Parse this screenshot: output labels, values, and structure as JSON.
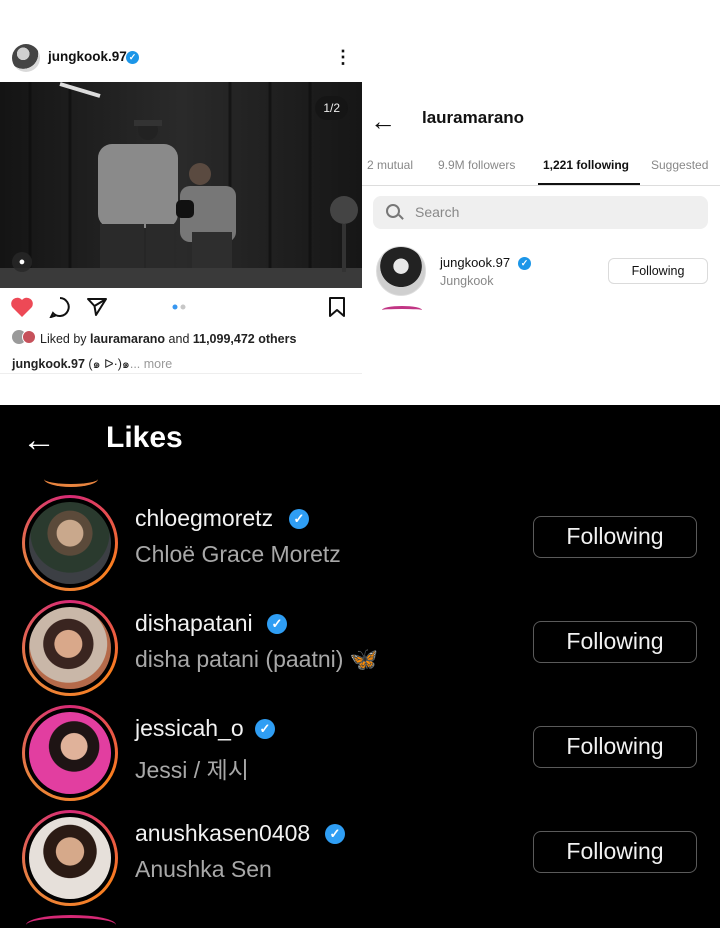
{
  "post": {
    "username": "jungkook.97",
    "menu_glyph": "⋮",
    "pager": "1/2",
    "liked_by_prefix": "Liked by ",
    "liked_by_user": "lauramarano",
    "liked_by_mid": " and ",
    "liked_by_count": "11,099,472 others",
    "caption_user": "jungkook.97",
    "caption_text": " (๑ ᐅ·)๑",
    "caption_more": "... more"
  },
  "profile": {
    "back_glyph": "←",
    "username": "lauramarano",
    "tabs": [
      "2 mutual",
      "9.9M followers",
      "1,221 following",
      "Suggested"
    ],
    "active_tab": "1,221 following",
    "search_placeholder": "Search",
    "row": {
      "username": "jungkook.97",
      "full_name": "Jungkook",
      "button": "Following"
    }
  },
  "likes": {
    "back_glyph": "←",
    "title": "Likes",
    "users": [
      {
        "username": "chloegmoretz",
        "full_name": "Chloë Grace Moretz",
        "button": "Following"
      },
      {
        "username": "dishapatani",
        "full_name": "disha patani (paatni) 🦋",
        "button": "Following"
      },
      {
        "username": "jessicah_o",
        "full_name": "Jessi / 제시",
        "button": "Following"
      },
      {
        "username": "anushkasen0408",
        "full_name": "Anushka Sen",
        "button": "Following"
      }
    ]
  },
  "colors": {
    "verified_blue": "#2f9ef4",
    "like_red": "#ed4956",
    "story_ring_a": "#d62976",
    "story_ring_b": "#fa7e1e"
  },
  "icons": {
    "like": "heart-icon",
    "comment": "comment-icon",
    "share": "send-icon",
    "save": "bookmark-icon",
    "tag": "person-tag-icon"
  }
}
